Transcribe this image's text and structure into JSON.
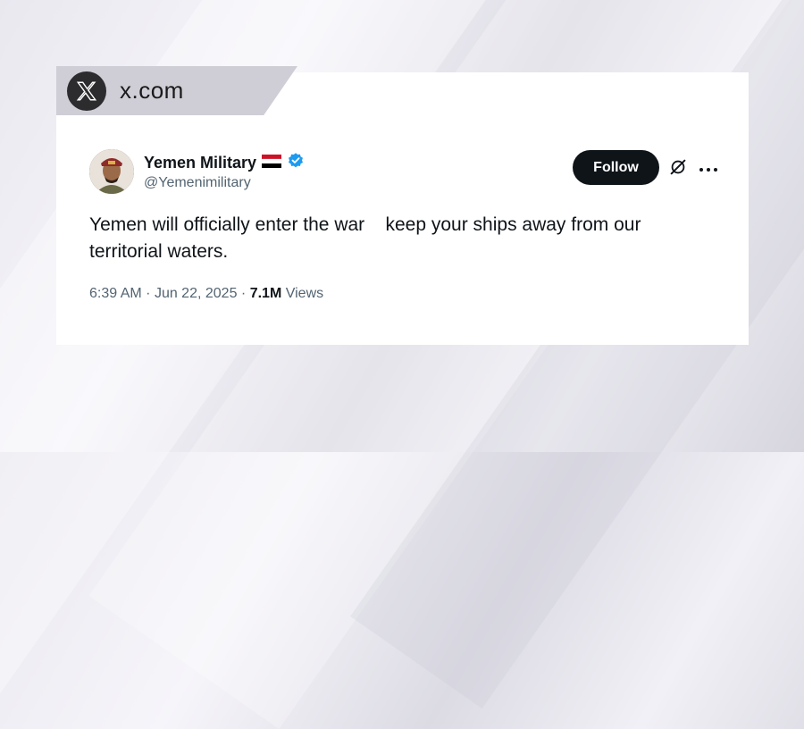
{
  "source": {
    "label": "x.com",
    "icon": "x-logo-icon"
  },
  "tweet": {
    "display_name": "Yemen Military",
    "handle": "@Yemenimilitary",
    "flag_icon": "yemen-flag-icon",
    "verified_icon": "verified-badge-icon",
    "follow_label": "Follow",
    "text": "Yemen will officially enter the war    keep your ships away from our territorial waters.",
    "time": "6:39 AM",
    "date": "Jun 22, 2025",
    "views_count": "7.1M",
    "views_label": "Views"
  },
  "colors": {
    "verified": "#1d9bf0",
    "follow_bg": "#0f1419"
  }
}
